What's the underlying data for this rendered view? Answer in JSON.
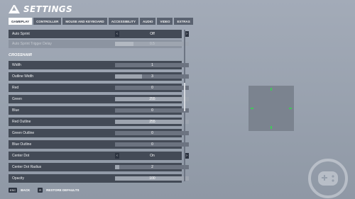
{
  "header": {
    "title": "SETTINGS",
    "logo_icon": "brand-logo"
  },
  "tabs": [
    {
      "label": "GAMEPLAY",
      "active": true
    },
    {
      "label": "CONTROLLER",
      "active": false
    },
    {
      "label": "MOUSE AND KEYBOARD",
      "active": false
    },
    {
      "label": "ACCESSIBILITY",
      "active": false
    },
    {
      "label": "AUDIO",
      "active": false
    },
    {
      "label": "VIDEO",
      "active": false
    },
    {
      "label": "EXTRAS",
      "active": false
    }
  ],
  "settings": {
    "auto_sprint": {
      "label": "Auto Sprint",
      "value": "Off"
    },
    "auto_sprint_trigger_delay": {
      "label": "Auto Sprint Trigger Delay",
      "value": "0.5",
      "fill": 0.25
    },
    "crosshair_section": "CROSSHAIR",
    "width": {
      "label": "Width",
      "value": "1",
      "fill": 0.0
    },
    "outline_width": {
      "label": "Outline Width",
      "value": "3",
      "fill": 0.37
    },
    "red": {
      "label": "Red",
      "value": "0",
      "fill": 0.0
    },
    "green": {
      "label": "Green",
      "value": "255",
      "fill": 1.0
    },
    "blue": {
      "label": "Blue",
      "value": "0",
      "fill": 0.0
    },
    "red_outline": {
      "label": "Red Outline",
      "value": "255",
      "fill": 1.0
    },
    "green_outline": {
      "label": "Green Outline",
      "value": "0",
      "fill": 0.0
    },
    "blue_outline": {
      "label": "Blue Outline",
      "value": "0",
      "fill": 0.0
    },
    "center_dot": {
      "label": "Center Dot",
      "value": "On"
    },
    "center_dot_radius": {
      "label": "Center Dot Radius",
      "value": "2",
      "fill": 0.06
    },
    "opacity": {
      "label": "Opacity",
      "value": "100",
      "fill": 1.0
    }
  },
  "footer": {
    "back_key": "ESC",
    "back_label": "BACK",
    "restore_key": "R",
    "restore_label": "RESTORE DEFAULTS"
  },
  "colors": {
    "crosshair": "#41c85a",
    "row_bg": "#434a56",
    "active_tab": "#ffffff"
  }
}
